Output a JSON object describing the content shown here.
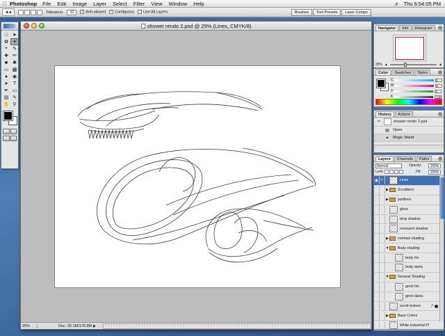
{
  "menubar": {
    "app": "Photoshop",
    "items": [
      "File",
      "Edit",
      "Image",
      "Layer",
      "Select",
      "Filter",
      "View",
      "Window",
      "Help"
    ],
    "clock": "Thu 6:54:05 PM"
  },
  "options": {
    "tolerance_label": "Tolerance:",
    "tolerance_value": "32",
    "anti_aliased": "Anti-aliased",
    "contiguous": "Contiguous",
    "use_all_layers": "Use All Layers",
    "wells": [
      "Brushes",
      "Tool Presets",
      "Layer Comps"
    ]
  },
  "document": {
    "title": "shower rendo 2.psd @ 25% (Lines, CMYK/8)",
    "zoom": "25%",
    "doc_info": "Doc: 32.1M/176.9M"
  },
  "navigator": {
    "tabs": [
      "Navigator",
      "Info",
      "Histogram"
    ],
    "zoom": "25%"
  },
  "color_panel": {
    "tabs": [
      "Color",
      "Swatches",
      "Styles"
    ],
    "channels": [
      {
        "label": "C",
        "color": "#00aeef",
        "value": "0"
      },
      {
        "label": "M",
        "color": "#ec008c",
        "value": "0"
      },
      {
        "label": "Y",
        "color": "#1a9c3a",
        "value": "0"
      },
      {
        "label": "K",
        "color": "#3a3a3a",
        "value": "100"
      }
    ]
  },
  "history": {
    "tabs": [
      "History",
      "Actions"
    ],
    "snapshot": "shower rendo 2.psd",
    "states": [
      "Open",
      "Magic Wand"
    ]
  },
  "layers": {
    "tabs": [
      "Layers",
      "Channels",
      "Paths"
    ],
    "blend_mode": "Normal",
    "opacity_label": "Opacity:",
    "opacity": "100%",
    "lock_label": "Lock:",
    "fill_label": "Fill:",
    "fill": "100%",
    "rows": [
      {
        "name": "Lines",
        "kind": "layer",
        "selected": true
      },
      {
        "name": "Scrubbers",
        "kind": "group"
      },
      {
        "name": "partlines",
        "kind": "group"
      },
      {
        "name": "gloss",
        "kind": "layer"
      },
      {
        "name": "drop shadow",
        "kind": "layer"
      },
      {
        "name": "recessed shadow",
        "kind": "layer"
      },
      {
        "name": "contrast shading",
        "kind": "group"
      },
      {
        "name": "Body shading",
        "kind": "group-open"
      },
      {
        "name": "body h/s",
        "kind": "sublayer"
      },
      {
        "name": "body darks",
        "kind": "sublayer"
      },
      {
        "name": "General Shading",
        "kind": "group-open"
      },
      {
        "name": "genrl h/s",
        "kind": "sublayer"
      },
      {
        "name": "genrl darks",
        "kind": "sublayer"
      },
      {
        "name": "scrub texture",
        "kind": "layer-fx"
      },
      {
        "name": "Base Colors",
        "kind": "group"
      },
      {
        "name": "White Industrial Pl",
        "kind": "layer"
      }
    ]
  }
}
